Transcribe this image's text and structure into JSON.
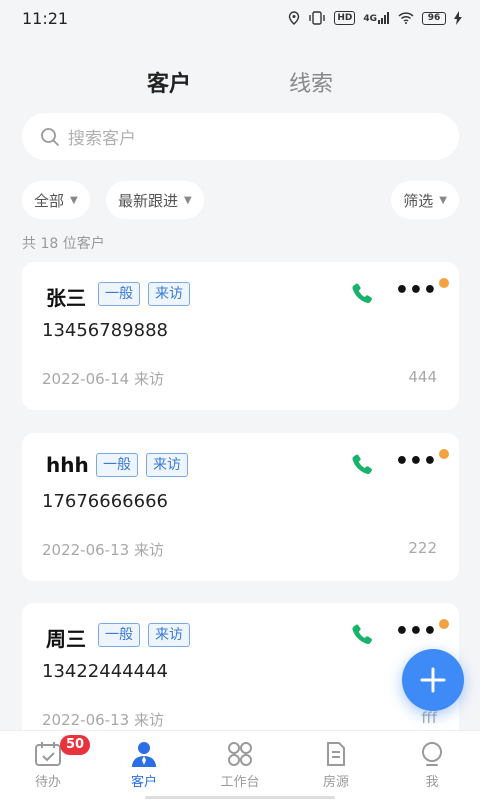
{
  "status_bar": {
    "time": "11:21",
    "network": "4G",
    "hd": "HD",
    "battery": "96"
  },
  "tabs": [
    {
      "label": "客户",
      "active": true
    },
    {
      "label": "线索",
      "active": false
    }
  ],
  "search": {
    "placeholder": "搜索客户"
  },
  "filters": {
    "all": "全部",
    "latest": "最新跟进",
    "filter": "筛选"
  },
  "count_text": "共 18 位客户",
  "customers": [
    {
      "name": "张三",
      "tags": [
        "一般",
        "来访"
      ],
      "phone": "13456789888",
      "date": "2022-06-14 来访",
      "note": "444"
    },
    {
      "name": "hhh",
      "tags": [
        "一般",
        "来访"
      ],
      "phone": "17676666666",
      "date": "2022-06-13 来访",
      "note": "222"
    },
    {
      "name": "周三",
      "tags": [
        "一般",
        "来访"
      ],
      "phone": "13422444444",
      "date": "2022-06-13 来访",
      "note": "fff"
    }
  ],
  "bottom_nav": [
    {
      "label": "待办",
      "icon": "calendar-check-icon",
      "badge": "50",
      "active": false
    },
    {
      "label": "客户",
      "icon": "person-icon",
      "active": true
    },
    {
      "label": "工作台",
      "icon": "grid-clover-icon",
      "active": false
    },
    {
      "label": "房源",
      "icon": "document-icon",
      "active": false
    },
    {
      "label": "我",
      "icon": "profile-bulb-icon",
      "active": false
    }
  ],
  "colors": {
    "accent": "#3e8af7",
    "nav_active": "#2b6fe6",
    "phone_green": "#18b26b",
    "tag_border": "#7aaae6",
    "dot_orange": "#f4a142",
    "badge_red": "#e8323c"
  }
}
